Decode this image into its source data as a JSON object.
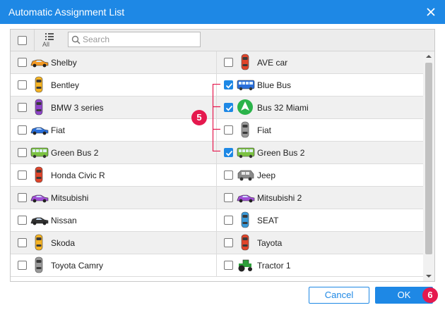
{
  "window": {
    "title": "Automatic Assignment List"
  },
  "toolbar": {
    "all_label": "All",
    "search_placeholder": "Search",
    "search_value": ""
  },
  "items": {
    "left": [
      {
        "name": "Shelby",
        "checked": false,
        "icon": "orange-sports-car-icon",
        "color": "#f59a23"
      },
      {
        "name": "Bentley",
        "checked": false,
        "icon": "yellow-car-topview-icon",
        "color": "#f5b324"
      },
      {
        "name": "BMW 3 series",
        "checked": false,
        "icon": "purple-car-topview-icon",
        "color": "#8e44c8"
      },
      {
        "name": "Fiat",
        "checked": false,
        "icon": "blue-car-icon",
        "color": "#2a6fdb"
      },
      {
        "name": "Green Bus 2",
        "checked": false,
        "icon": "green-bus-icon",
        "color": "#7cc242"
      },
      {
        "name": "Honda Civic R",
        "checked": false,
        "icon": "red-car-topview-icon",
        "color": "#e0452b"
      },
      {
        "name": "Mitsubishi",
        "checked": false,
        "icon": "purple-car-icon",
        "color": "#a14fd6"
      },
      {
        "name": "Nissan",
        "checked": false,
        "icon": "black-car-icon",
        "color": "#333333"
      },
      {
        "name": "Skoda",
        "checked": false,
        "icon": "yellow-car-topview-icon",
        "color": "#f5b324"
      },
      {
        "name": "Toyota Camry",
        "checked": false,
        "icon": "grey-car-topview-icon",
        "color": "#9a9a9a"
      }
    ],
    "right": [
      {
        "name": "AVE car",
        "checked": false,
        "icon": "red-car-topview-icon",
        "color": "#e0452b"
      },
      {
        "name": "Blue Bus",
        "checked": true,
        "icon": "blue-bus-icon",
        "color": "#2a6fdb"
      },
      {
        "name": "Bus 32 Miami",
        "checked": true,
        "icon": "green-arrow-marker-icon",
        "color": "#2bb34a"
      },
      {
        "name": "Fiat",
        "checked": false,
        "icon": "grey-car-topview-icon",
        "color": "#9a9a9a"
      },
      {
        "name": "Green Bus 2",
        "checked": true,
        "icon": "green-bus-icon",
        "color": "#7cc242"
      },
      {
        "name": "Jeep",
        "checked": false,
        "icon": "grey-suv-icon",
        "color": "#8a8a8a"
      },
      {
        "name": "Mitsubishi 2",
        "checked": false,
        "icon": "purple-car-icon",
        "color": "#a14fd6"
      },
      {
        "name": "SEAT",
        "checked": false,
        "icon": "blue-car-topview-icon",
        "color": "#3a9ad9"
      },
      {
        "name": "Tayota",
        "checked": false,
        "icon": "red-car-topview-icon",
        "color": "#e0452b"
      },
      {
        "name": "Tractor 1",
        "checked": false,
        "icon": "green-tractor-icon",
        "color": "#2e9e3a"
      }
    ]
  },
  "annotations": {
    "callout_bracket": "5",
    "callout_ok": "6"
  },
  "buttons": {
    "cancel": "Cancel",
    "ok": "OK"
  },
  "colors": {
    "accent": "#1e88e5",
    "callout": "#e5194e"
  }
}
